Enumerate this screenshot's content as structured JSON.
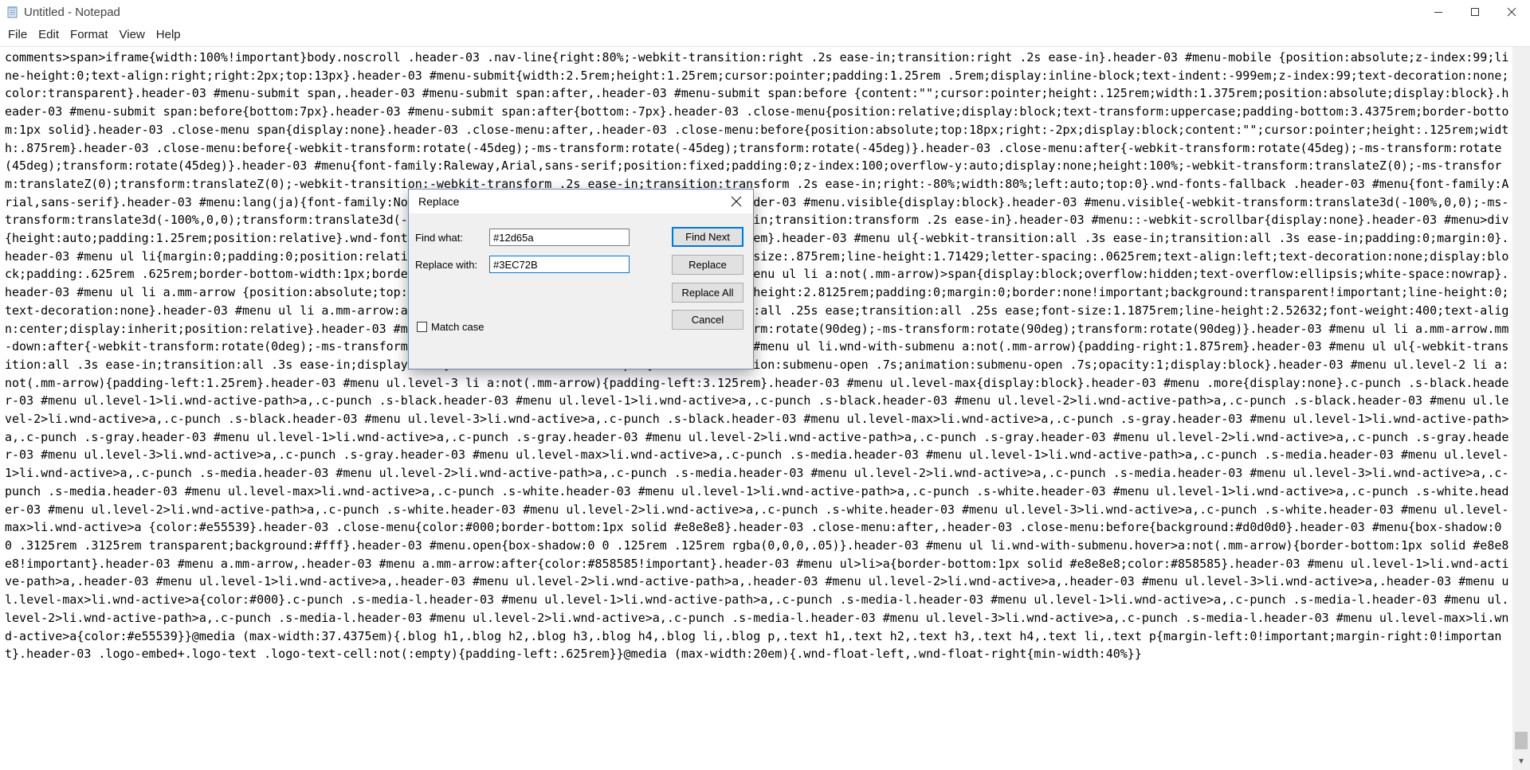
{
  "window": {
    "title": "Untitled - Notepad",
    "minimize_glyph": "—",
    "maximize_glyph": "☐",
    "close_glyph": "✕"
  },
  "menu": {
    "items": [
      "File",
      "Edit",
      "Format",
      "View",
      "Help"
    ]
  },
  "editor": {
    "content": "comments>span>iframe{width:100%!important}body.noscroll .header-03 .nav-line{right:80%;-webkit-transition:right .2s ease-in;transition:right .2s ease-in}.header-03 #menu-mobile {position:absolute;z-index:99;line-height:0;text-align:right;right:2px;top:13px}.header-03 #menu-submit{width:2.5rem;height:1.25rem;cursor:pointer;padding:1.25rem .5rem;display:inline-block;text-indent:-999em;z-index:99;text-decoration:none;color:transparent}.header-03 #menu-submit span,.header-03 #menu-submit span:after,.header-03 #menu-submit span:before {content:\"\";cursor:pointer;height:.125rem;width:1.375rem;position:absolute;display:block}.header-03 #menu-submit span:before{bottom:7px}.header-03 #menu-submit span:after{bottom:-7px}.header-03 .close-menu{position:relative;display:block;text-transform:uppercase;padding-bottom:3.4375rem;border-bottom:1px solid}.header-03 .close-menu span{display:none}.header-03 .close-menu:after,.header-03 .close-menu:before{position:absolute;top:18px;right:-2px;display:block;content:\"\";cursor:pointer;height:.125rem;width:.875rem}.header-03 .close-menu:before{-webkit-transform:rotate(-45deg);-ms-transform:rotate(-45deg);transform:rotate(-45deg)}.header-03 .close-menu:after{-webkit-transform:rotate(45deg);-ms-transform:rotate (45deg);transform:rotate(45deg)}.header-03 #menu{font-family:Raleway,Arial,sans-serif;position:fixed;padding:0;z-index:100;overflow-y:auto;display:none;height:100%;-webkit-transform:translateZ(0);-ms-transform:translateZ(0);transform:translateZ(0);-webkit-transition:-webkit-transform .2s ease-in;transition:transform .2s ease-in;right:-80%;width:80%;left:auto;top:0}.wnd-fonts-fallback .header-03 #menu{font-family:Arial,sans-serif}.header-03 #menu:lang(ja){font-family:Noto Sans Japanese,Noto Sans,Arial,sans-serif}.header-03 #menu.visible{display:block}.header-03 #menu.visible{-webkit-transform:translate3d(-100%,0,0);-ms-transform:translate3d(-100%,0,0);transform:translate3d(-100%,0,0);-webkit-transition:transform .2s ease-in;transition:transform .2s ease-in}.header-03 #menu::-webkit-scrollbar{display:none}.header-03 #menu>div {height:auto;padding:1.25rem;position:relative}.wnd-fonts-fallback .header-03 #menu{padding-bottom:1.25rem}.header-03 #menu ul{-webkit-transition:all .3s ease-in;transition:all .3s ease-in;padding:0;margin:0}.header-03 #menu ul li{margin:0;padding:0;position:relative}.header-03 #menu ul li a:not(.mm-arrow){font-size:.875rem;line-height:1.71429;letter-spacing:.0625rem;text-align:left;text-decoration:none;display:block;padding:.625rem .625rem;border-bottom-width:1px;border-bottom-style:solid;display:block}.header-03 #menu ul li a:not(.mm-arrow)>span{display:block;overflow:hidden;text-overflow:ellipsis;white-space:nowrap}.header-03 #menu ul li a.mm-arrow {position:absolute;top:0;left:auto;bottom:auto;right:0;width:2.8125rem;height:2.8125rem;padding:0;margin:0;border:none!important;background:transparent!important;line-height:0;text-decoration:none}.header-03 #menu ul li a.mm-arrow:after{font-family:WebnodeIcons;-webkit-transition:all .25s ease;transition:all .25s ease;font-size:1.1875rem;line-height:2.52632;font-weight:400;text-align:center;display:inherit;position:relative}.header-03 #menu ul li a.mm-arrow.mm-up:after{-webkit-transform:rotate(90deg);-ms-transform:rotate(90deg);transform:rotate(90deg)}.header-03 #menu ul li a.mm-arrow.mm-down:after{-webkit-transform:rotate(0deg);-ms-transform:rotate(0deg);transform:rotate(0deg)}.header-03 #menu ul li.wnd-with-submenu a:not(.mm-arrow){padding-right:1.875rem}.header-03 #menu ul ul{-webkit-transition:all .3s ease-in;transition:all .3s ease-in;display:none}.header-03 #menu ul ul.open{-webkit-animation:submenu-open .7s;animation:submenu-open .7s;opacity:1;display:block}.header-03 #menu ul.level-2 li a:not(.mm-arrow){padding-left:1.25rem}.header-03 #menu ul.level-3 li a:not(.mm-arrow){padding-left:3.125rem}.header-03 #menu ul.level-max{display:block}.header-03 #menu .more{display:none}.c-punch .s-black.header-03 #menu ul.level-1>li.wnd-active-path>a,.c-punch .s-black.header-03 #menu ul.level-1>li.wnd-active>a,.c-punch .s-black.header-03 #menu ul.level-2>li.wnd-active-path>a,.c-punch .s-black.header-03 #menu ul.level-2>li.wnd-active>a,.c-punch .s-black.header-03 #menu ul.level-3>li.wnd-active>a,.c-punch .s-black.header-03 #menu ul.level-max>li.wnd-active>a,.c-punch .s-gray.header-03 #menu ul.level-1>li.wnd-active-path>a,.c-punch .s-gray.header-03 #menu ul.level-1>li.wnd-active>a,.c-punch .s-gray.header-03 #menu ul.level-2>li.wnd-active-path>a,.c-punch .s-gray.header-03 #menu ul.level-2>li.wnd-active>a,.c-punch .s-gray.header-03 #menu ul.level-3>li.wnd-active>a,.c-punch .s-gray.header-03 #menu ul.level-max>li.wnd-active>a,.c-punch .s-media.header-03 #menu ul.level-1>li.wnd-active-path>a,.c-punch .s-media.header-03 #menu ul.level-1>li.wnd-active>a,.c-punch .s-media.header-03 #menu ul.level-2>li.wnd-active-path>a,.c-punch .s-media.header-03 #menu ul.level-2>li.wnd-active>a,.c-punch .s-media.header-03 #menu ul.level-3>li.wnd-active>a,.c-punch .s-media.header-03 #menu ul.level-max>li.wnd-active>a,.c-punch .s-white.header-03 #menu ul.level-1>li.wnd-active-path>a,.c-punch .s-white.header-03 #menu ul.level-1>li.wnd-active>a,.c-punch .s-white.header-03 #menu ul.level-2>li.wnd-active-path>a,.c-punch .s-white.header-03 #menu ul.level-2>li.wnd-active>a,.c-punch .s-white.header-03 #menu ul.level-3>li.wnd-active>a,.c-punch .s-white.header-03 #menu ul.level-max>li.wnd-active>a {color:#e55539}.header-03 .close-menu{color:#000;border-bottom:1px solid #e8e8e8}.header-03 .close-menu:after,.header-03 .close-menu:before{background:#d0d0d0}.header-03 #menu{box-shadow:0 0 .3125rem .3125rem transparent;background:#fff}.header-03 #menu.open{box-shadow:0 0 .125rem .125rem rgba(0,0,0,.05)}.header-03 #menu ul li.wnd-with-submenu.hover>a:not(.mm-arrow){border-bottom:1px solid #e8e8e8!important}.header-03 #menu a.mm-arrow,.header-03 #menu a.mm-arrow:after{color:#858585!important}.header-03 #menu ul>li>a{border-bottom:1px solid #e8e8e8;color:#858585}.header-03 #menu ul.level-1>li.wnd-active-path>a,.header-03 #menu ul.level-1>li.wnd-active>a,.header-03 #menu ul.level-2>li.wnd-active-path>a,.header-03 #menu ul.level-2>li.wnd-active>a,.header-03 #menu ul.level-3>li.wnd-active>a,.header-03 #menu ul.level-max>li.wnd-active>a{color:#000}.c-punch .s-media-l.header-03 #menu ul.level-1>li.wnd-active-path>a,.c-punch .s-media-l.header-03 #menu ul.level-1>li.wnd-active>a,.c-punch .s-media-l.header-03 #menu ul.level-2>li.wnd-active-path>a,.c-punch .s-media-l.header-03 #menu ul.level-2>li.wnd-active>a,.c-punch .s-media-l.header-03 #menu ul.level-3>li.wnd-active>a,.c-punch .s-media-l.header-03 #menu ul.level-max>li.wnd-active>a{color:#e55539}}@media (max-width:37.4375em){.blog h1,.blog h2,.blog h3,.blog h4,.blog li,.blog p,.text h1,.text h2,.text h3,.text h4,.text li,.text p{margin-left:0!important;margin-right:0!important}.header-03 .logo-embed+.logo-text .logo-text-cell:not(:empty){padding-left:.625rem}}@media (max-width:20em){.wnd-float-left,.wnd-float-right{min-width:40%}}"
  },
  "dialog": {
    "title": "Replace",
    "find_label": "Find what:",
    "find_value": "#12d65a",
    "replace_label": "Replace with:",
    "replace_value": "#3EC72B",
    "find_next_label": "Find Next",
    "replace_button_label": "Replace",
    "replace_all_label": "Replace All",
    "cancel_label": "Cancel",
    "match_case_label": "Match case",
    "match_case_checked": false
  },
  "colors": {
    "accent": "#0078d7",
    "dialog_bg": "#f0f0f0"
  },
  "icons": {
    "app": "notepad-icon",
    "dialog_close": "close-icon"
  }
}
